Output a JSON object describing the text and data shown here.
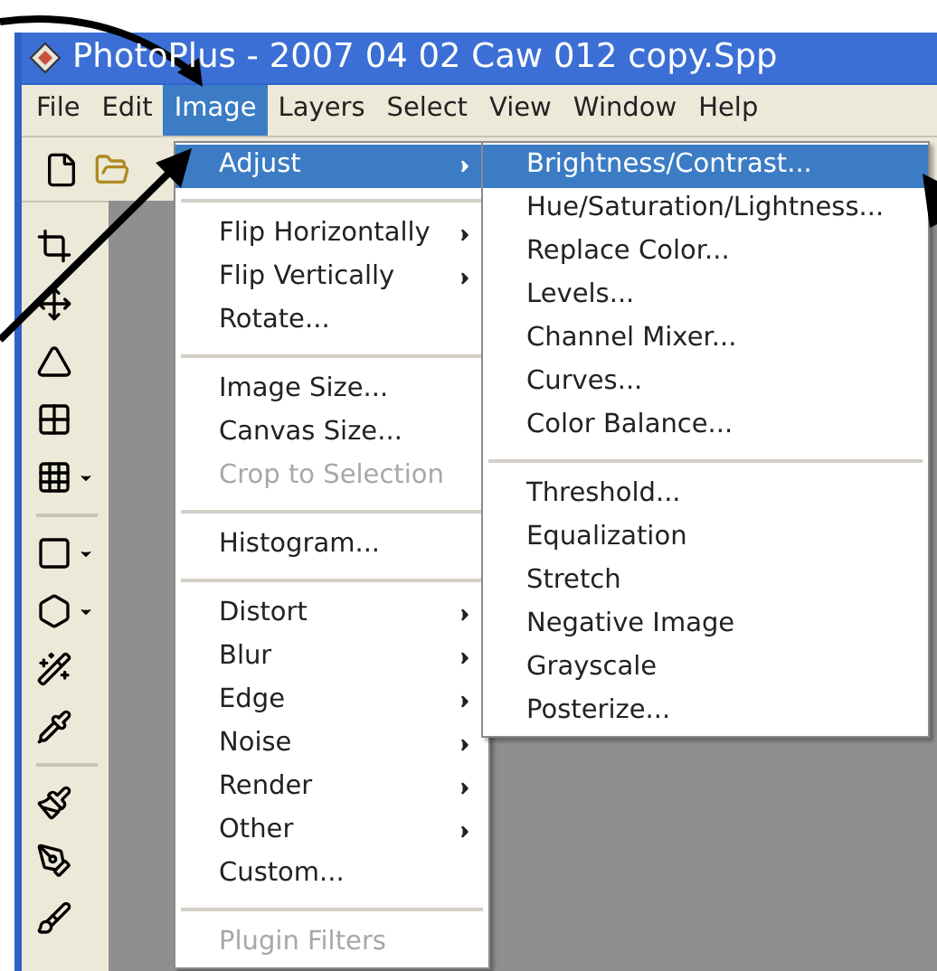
{
  "window": {
    "title": "PhotoPlus - 2007 04 02 Caw 012 copy.Spp"
  },
  "menu_bar": [
    {
      "label": "File",
      "selected": false
    },
    {
      "label": "Edit",
      "selected": false
    },
    {
      "label": "Image",
      "selected": true
    },
    {
      "label": "Layers",
      "selected": false
    },
    {
      "label": "Select",
      "selected": false
    },
    {
      "label": "View",
      "selected": false
    },
    {
      "label": "Window",
      "selected": false
    },
    {
      "label": "Help",
      "selected": false
    }
  ],
  "image_menu": [
    {
      "kind": "item",
      "label": "Adjust",
      "submenu": true,
      "selected": true,
      "disabled": false
    },
    {
      "kind": "separator"
    },
    {
      "kind": "item",
      "label": "Flip Horizontally",
      "submenu": true,
      "selected": false,
      "disabled": false
    },
    {
      "kind": "item",
      "label": "Flip Vertically",
      "submenu": true,
      "selected": false,
      "disabled": false
    },
    {
      "kind": "item",
      "label": "Rotate...",
      "submenu": false,
      "selected": false,
      "disabled": false
    },
    {
      "kind": "separator"
    },
    {
      "kind": "item",
      "label": "Image Size...",
      "submenu": false,
      "selected": false,
      "disabled": false
    },
    {
      "kind": "item",
      "label": "Canvas Size...",
      "submenu": false,
      "selected": false,
      "disabled": false
    },
    {
      "kind": "item",
      "label": "Crop to Selection",
      "submenu": false,
      "selected": false,
      "disabled": true
    },
    {
      "kind": "separator"
    },
    {
      "kind": "item",
      "label": "Histogram...",
      "submenu": false,
      "selected": false,
      "disabled": false
    },
    {
      "kind": "separator"
    },
    {
      "kind": "item",
      "label": "Distort",
      "submenu": true,
      "selected": false,
      "disabled": false
    },
    {
      "kind": "item",
      "label": "Blur",
      "submenu": true,
      "selected": false,
      "disabled": false
    },
    {
      "kind": "item",
      "label": "Edge",
      "submenu": true,
      "selected": false,
      "disabled": false
    },
    {
      "kind": "item",
      "label": "Noise",
      "submenu": true,
      "selected": false,
      "disabled": false
    },
    {
      "kind": "item",
      "label": "Render",
      "submenu": true,
      "selected": false,
      "disabled": false
    },
    {
      "kind": "item",
      "label": "Other",
      "submenu": true,
      "selected": false,
      "disabled": false
    },
    {
      "kind": "item",
      "label": "Custom...",
      "submenu": false,
      "selected": false,
      "disabled": false
    },
    {
      "kind": "separator"
    },
    {
      "kind": "item",
      "label": "Plugin Filters",
      "submenu": false,
      "selected": false,
      "disabled": true
    }
  ],
  "adjust_submenu": [
    {
      "kind": "item",
      "label": "Brightness/Contrast...",
      "selected": true
    },
    {
      "kind": "item",
      "label": "Hue/Saturation/Lightness...",
      "selected": false
    },
    {
      "kind": "item",
      "label": "Replace Color...",
      "selected": false
    },
    {
      "kind": "item",
      "label": "Levels...",
      "selected": false
    },
    {
      "kind": "item",
      "label": "Channel Mixer...",
      "selected": false
    },
    {
      "kind": "item",
      "label": "Curves...",
      "selected": false
    },
    {
      "kind": "item",
      "label": "Color Balance...",
      "selected": false
    },
    {
      "kind": "separator"
    },
    {
      "kind": "item",
      "label": "Threshold...",
      "selected": false
    },
    {
      "kind": "item",
      "label": "Equalization",
      "selected": false
    },
    {
      "kind": "item",
      "label": "Stretch",
      "selected": false
    },
    {
      "kind": "item",
      "label": "Negative Image",
      "selected": false
    },
    {
      "kind": "item",
      "label": "Grayscale",
      "selected": false
    },
    {
      "kind": "item",
      "label": "Posterize...",
      "selected": false
    }
  ]
}
